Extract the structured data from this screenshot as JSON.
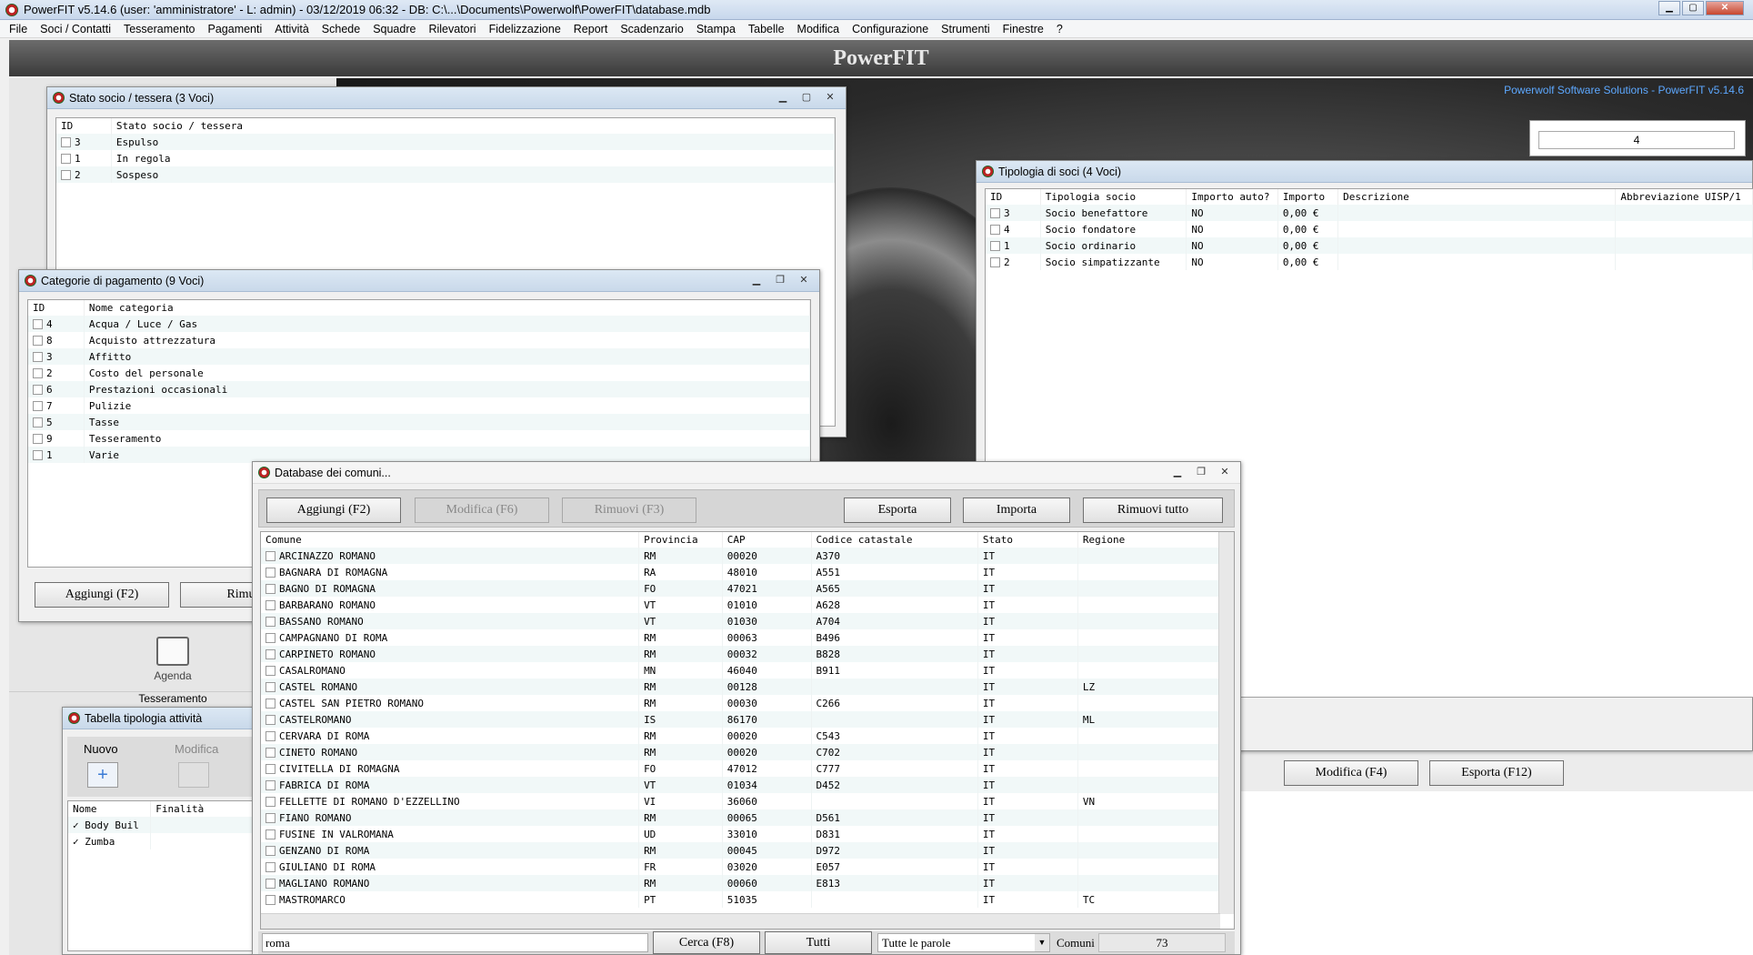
{
  "app": {
    "title": "PowerFIT v5.14.6  (user: 'amministratore'  - L: admin) - 03/12/2019 06:32 - DB: C:\\...\\Documents\\Powerwolf\\PowerFIT\\database.mdb",
    "banner": "PowerFIT",
    "brand": "Powerwolf Software Solutions - PowerFIT v5.14.6",
    "counter_value": "4"
  },
  "menu": [
    "File",
    "Soci / Contatti",
    "Tesseramento",
    "Pagamenti",
    "Attività",
    "Schede",
    "Squadre",
    "Rilevatori",
    "Fidelizzazione",
    "Report",
    "Scadenzario",
    "Stampa",
    "Tabelle",
    "Modifica",
    "Configurazione",
    "Strumenti",
    "Finestre",
    "?"
  ],
  "stato_socio": {
    "title": "Stato socio / tessera (3 Voci)",
    "headers": [
      "ID",
      "Stato socio / tessera"
    ],
    "rows": [
      [
        "3",
        "Espulso"
      ],
      [
        "1",
        "In regola"
      ],
      [
        "2",
        "Sospeso"
      ]
    ]
  },
  "categorie": {
    "title": "Categorie di pagamento (9 Voci)",
    "headers": [
      "ID",
      "Nome categoria"
    ],
    "rows": [
      [
        "4",
        "Acqua / Luce / Gas"
      ],
      [
        "8",
        "Acquisto attrezzatura"
      ],
      [
        "3",
        "Affitto"
      ],
      [
        "2",
        "Costo del personale"
      ],
      [
        "6",
        "Prestazioni occasionali"
      ],
      [
        "7",
        "Pulizie"
      ],
      [
        "5",
        "Tasse"
      ],
      [
        "9",
        "Tesseramento"
      ],
      [
        "1",
        "Varie"
      ]
    ],
    "add_label": "Aggiungi (F2)",
    "remove_label": "Rimuov"
  },
  "tipologia_soci": {
    "title": "Tipologia di soci (4 Voci)",
    "headers": [
      "ID",
      "Tipologia socio",
      "Importo auto?",
      "Importo",
      "Descrizione",
      "Abbreviazione UISP/1"
    ],
    "rows": [
      [
        "3",
        "Socio benefattore",
        "NO",
        "0,00 €"
      ],
      [
        "4",
        "Socio fondatore",
        "NO",
        "0,00 €"
      ],
      [
        "1",
        "Socio ordinario",
        "NO",
        "0,00 €"
      ],
      [
        "2",
        "Socio simpatizzante",
        "NO",
        "0,00 €"
      ]
    ],
    "modify_label": "Modifica (F4)",
    "export_label": "Esporta (F12)"
  },
  "agenda": {
    "label": "Agenda",
    "tesseramento": "Tesseramento"
  },
  "tipologia_attivita": {
    "title": "Tabella tipologia attività",
    "new_label": "Nuovo",
    "modify_label": "Modifica",
    "headers": [
      "Nome",
      "Finalità"
    ],
    "rows": [
      [
        "Body Buil"
      ],
      [
        "Zumba"
      ]
    ]
  },
  "comuni": {
    "title": "Database dei comuni...",
    "buttons": {
      "add": "Aggiungi (F2)",
      "modify": "Modifica (F6)",
      "remove": "Rimuovi (F3)",
      "export": "Esporta",
      "import": "Importa",
      "remove_all": "Rimuovi tutto"
    },
    "headers": [
      "Comune",
      "Provincia",
      "CAP",
      "Codice catastale",
      "Stato",
      "Regione"
    ],
    "rows": [
      [
        "ARCINAZZO ROMANO",
        "RM",
        "00020",
        "A370",
        "IT",
        ""
      ],
      [
        "BAGNARA DI ROMAGNA",
        "RA",
        "48010",
        "A551",
        "IT",
        ""
      ],
      [
        "BAGNO DI ROMAGNA",
        "FO",
        "47021",
        "A565",
        "IT",
        ""
      ],
      [
        "BARBARANO ROMANO",
        "VT",
        "01010",
        "A628",
        "IT",
        ""
      ],
      [
        "BASSANO ROMANO",
        "VT",
        "01030",
        "A704",
        "IT",
        ""
      ],
      [
        "CAMPAGNANO DI ROMA",
        "RM",
        "00063",
        "B496",
        "IT",
        ""
      ],
      [
        "CARPINETO ROMANO",
        "RM",
        "00032",
        "B828",
        "IT",
        ""
      ],
      [
        "CASALROMANO",
        "MN",
        "46040",
        "B911",
        "IT",
        ""
      ],
      [
        "CASTEL ROMANO",
        "RM",
        "00128",
        "",
        "IT",
        "LZ"
      ],
      [
        "CASTEL SAN PIETRO ROMANO",
        "RM",
        "00030",
        "C266",
        "IT",
        ""
      ],
      [
        "CASTELROMANO",
        "IS",
        "86170",
        "",
        "IT",
        "ML"
      ],
      [
        "CERVARA DI ROMA",
        "RM",
        "00020",
        "C543",
        "IT",
        ""
      ],
      [
        "CINETO ROMANO",
        "RM",
        "00020",
        "C702",
        "IT",
        ""
      ],
      [
        "CIVITELLA DI ROMAGNA",
        "FO",
        "47012",
        "C777",
        "IT",
        ""
      ],
      [
        "FABRICA DI ROMA",
        "VT",
        "01034",
        "D452",
        "IT",
        ""
      ],
      [
        "FELLETTE DI ROMANO D'EZZELLINO",
        "VI",
        "36060",
        "",
        "IT",
        "VN"
      ],
      [
        "FIANO ROMANO",
        "RM",
        "00065",
        "D561",
        "IT",
        ""
      ],
      [
        "FUSINE IN VALROMANA",
        "UD",
        "33010",
        "D831",
        "IT",
        ""
      ],
      [
        "GENZANO DI ROMA",
        "RM",
        "00045",
        "D972",
        "IT",
        ""
      ],
      [
        "GIULIANO DI ROMA",
        "FR",
        "03020",
        "E057",
        "IT",
        ""
      ],
      [
        "MAGLIANO ROMANO",
        "RM",
        "00060",
        "E813",
        "IT",
        ""
      ],
      [
        "MASTROMARCO",
        "PT",
        "51035",
        "",
        "IT",
        "TC"
      ]
    ],
    "search_value": "roma",
    "search_button": "Cerca (F8)",
    "all_button": "Tutti",
    "mode_select": "Tutte le parole",
    "count_label": "Comuni",
    "count_value": "73"
  }
}
